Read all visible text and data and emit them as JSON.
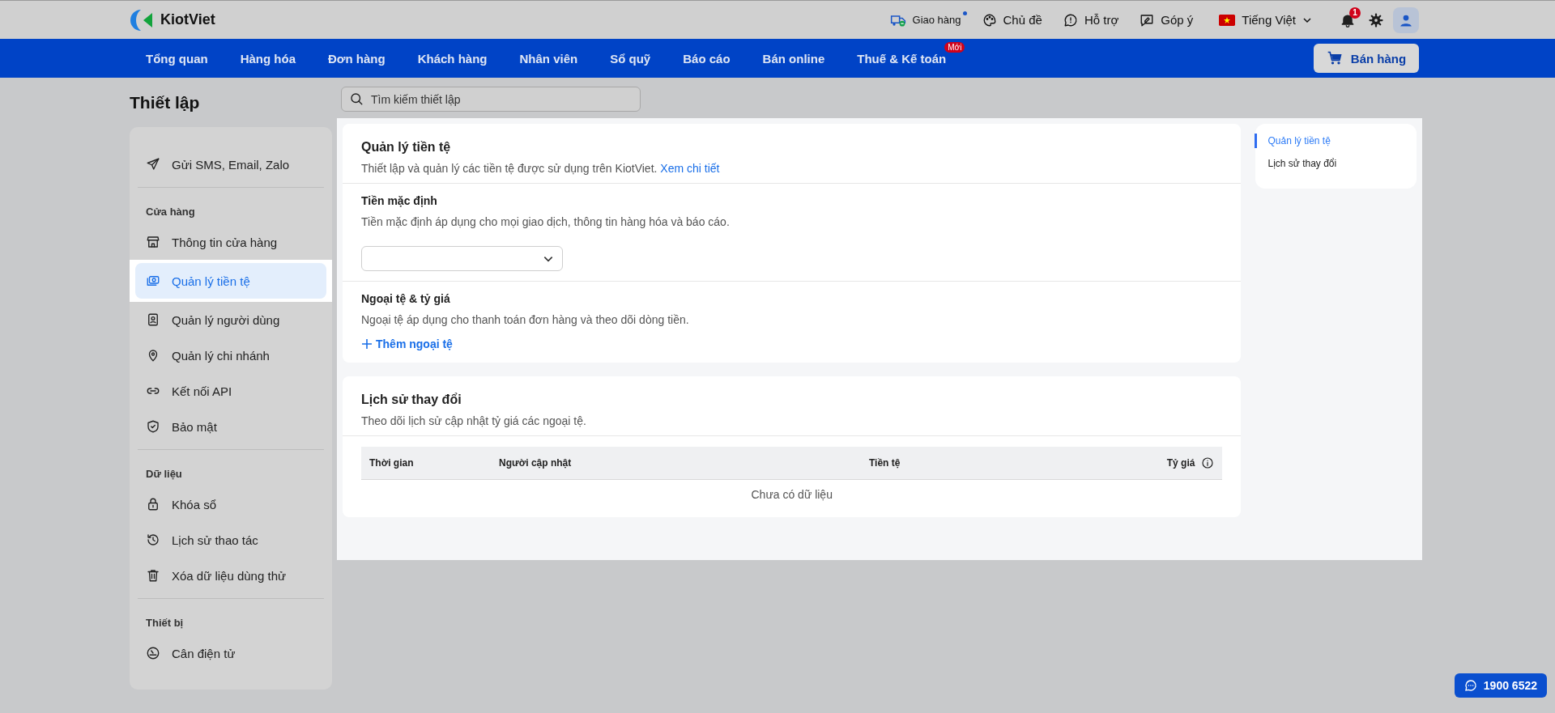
{
  "header": {
    "logo": "KiotViet",
    "actions": [
      {
        "kind": "delivery",
        "label": "Giao hàng",
        "dot": true
      },
      {
        "kind": "theme",
        "label": "Chủ đề",
        "dot": false
      },
      {
        "kind": "support",
        "label": "Hỗ trợ",
        "dot": false
      },
      {
        "kind": "feedback",
        "label": "Góp ý",
        "dot": false
      }
    ],
    "language": "Tiếng Việt",
    "notifications": "1"
  },
  "nav": {
    "items": [
      {
        "label": "Tổng quan"
      },
      {
        "label": "Hàng hóa"
      },
      {
        "label": "Đơn hàng"
      },
      {
        "label": "Khách hàng"
      },
      {
        "label": "Nhân viên"
      },
      {
        "label": "Sổ quỹ"
      },
      {
        "label": "Báo cáo"
      },
      {
        "label": "Bán online"
      },
      {
        "label": "Thuế & Kế toán",
        "badge": "Mới"
      }
    ],
    "sell_button": "Bán hàng"
  },
  "page_title": "Thiết lập",
  "search": {
    "placeholder": "Tìm kiếm thiết lập"
  },
  "sidebar": {
    "groups": [
      {
        "items": [
          {
            "label": "Gửi SMS, Email, Zalo",
            "selected": false
          }
        ]
      },
      {
        "title": "Cửa hàng",
        "items": [
          {
            "label": "Thông tin cửa hàng",
            "selected": false
          },
          {
            "label": "Quản lý tiền tệ",
            "selected": true
          },
          {
            "label": "Quản lý người dùng",
            "selected": false
          },
          {
            "label": "Quản lý chi nhánh",
            "selected": false
          },
          {
            "label": "Kết nối API",
            "selected": false
          },
          {
            "label": "Bảo mật",
            "selected": false
          }
        ]
      },
      {
        "title": "Dữ liệu",
        "items": [
          {
            "label": "Khóa sổ",
            "selected": false
          },
          {
            "label": "Lịch sử thao tác",
            "selected": false
          },
          {
            "label": "Xóa dữ liệu dùng thử",
            "selected": false
          }
        ]
      },
      {
        "title": "Thiết bị",
        "items": [
          {
            "label": "Cân điện tử",
            "selected": false
          }
        ]
      }
    ]
  },
  "currency_card": {
    "title": "Quản lý tiền tệ",
    "description": "Thiết lập và quản lý các tiền tệ được sử dụng trên KiotViet.",
    "link": "Xem chi tiết",
    "sections": [
      {
        "kind": "select",
        "title": "Tiền mặc định",
        "description": "Tiền mặc định áp dụng cho mọi giao dịch, thông tin hàng hóa và báo cáo."
      },
      {
        "kind": "add",
        "title": "Ngoại tệ & tỷ giá",
        "description": "Ngoại tệ áp dụng cho thanh toán đơn hàng và theo dõi dòng tiền.",
        "action": "Thêm ngoại tệ"
      }
    ]
  },
  "history_card": {
    "title": "Lịch sử thay đổi",
    "description": "Theo dõi lịch sử cập nhật tỷ giá các ngoại tệ.",
    "table": {
      "columns": [
        {
          "label": "Thời gian",
          "info": false
        },
        {
          "label": "Người cập nhật",
          "info": false
        },
        {
          "label": "Tiền tệ",
          "info": false
        },
        {
          "label": "Tỷ giá",
          "info": true
        }
      ],
      "empty": "Chưa có dữ liệu"
    }
  },
  "anchors": [
    {
      "label": "Quản lý tiền tệ",
      "selected": true
    },
    {
      "label": "Lịch sử thay đổi",
      "selected": false
    }
  ],
  "hotline": "1900 6522"
}
